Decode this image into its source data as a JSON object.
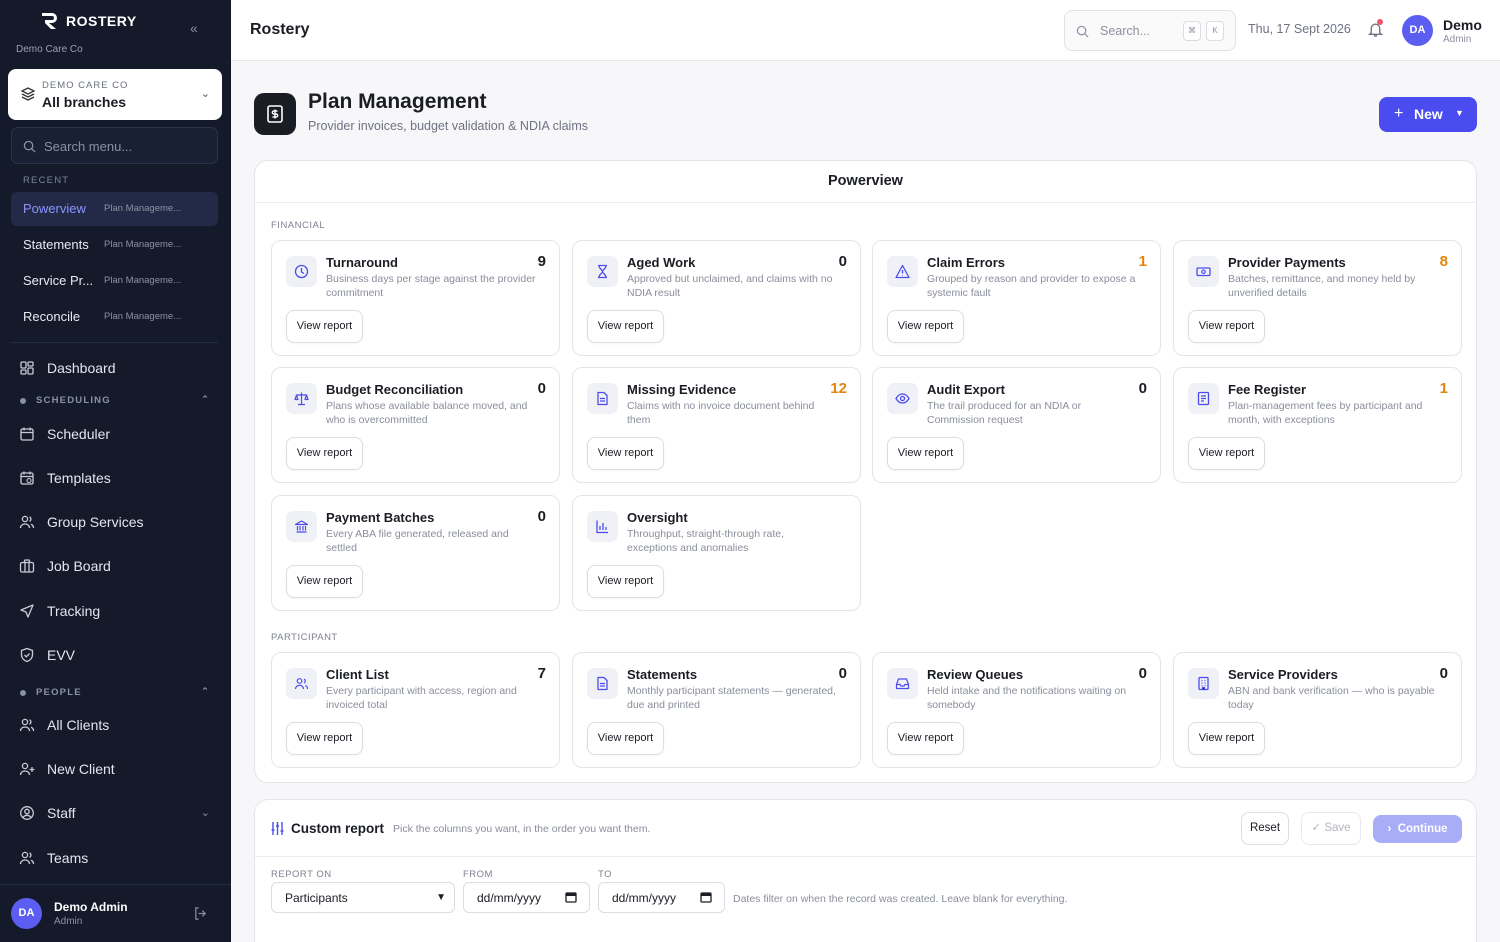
{
  "sidebar": {
    "brand": "ROSTERY",
    "org": "Demo Care Co",
    "branch_label": "DEMO CARE CO",
    "branch_value": "All branches",
    "search_placeholder": "Search menu...",
    "recent_label": "RECENT",
    "recent": [
      {
        "title": "Powerview",
        "sub": "Plan Manageme..."
      },
      {
        "title": "Statements",
        "sub": "Plan Manageme..."
      },
      {
        "title": "Service Pr...",
        "sub": "Plan Manageme..."
      },
      {
        "title": "Reconcile",
        "sub": "Plan Manageme..."
      }
    ],
    "dashboard": "Dashboard",
    "scheduling_label": "SCHEDULING",
    "scheduling": [
      "Scheduler",
      "Templates",
      "Group Services",
      "Job Board",
      "Tracking",
      "EVV"
    ],
    "people_label": "PEOPLE",
    "people": [
      "All Clients",
      "New Client",
      "Staff",
      "Teams"
    ],
    "user": {
      "initials": "DA",
      "name": "Demo Admin",
      "role": "Admin"
    }
  },
  "topbar": {
    "title": "Rostery",
    "search_placeholder": "Search...",
    "kbd1": "⌘",
    "kbd2": "K",
    "date": "Thu, 17 Sept 2026",
    "user_initials": "DA",
    "user_name": "Demo",
    "user_role": "Admin"
  },
  "page": {
    "title": "Plan Management",
    "subtitle": "Provider invoices, budget validation & NDIA claims",
    "new_label": "New"
  },
  "powerview": {
    "title": "Powerview",
    "view_label": "View report",
    "financial_label": "FINANCIAL",
    "participant_label": "PARTICIPANT",
    "financial": [
      {
        "title": "Turnaround",
        "desc": "Business days per stage against the provider commitment",
        "count": "9",
        "icon": "clock-icon"
      },
      {
        "title": "Aged Work",
        "desc": "Approved but unclaimed, and claims with no NDIA result",
        "count": "0",
        "icon": "hourglass-icon"
      },
      {
        "title": "Claim Errors",
        "desc": "Grouped by reason and provider to expose a systemic fault",
        "count": "1",
        "icon": "warning-icon"
      },
      {
        "title": "Provider Payments",
        "desc": "Batches, remittance, and money held by unverified details",
        "count": "8",
        "icon": "banknote-icon"
      },
      {
        "title": "Budget Reconciliation",
        "desc": "Plans whose available balance moved, and who is overcommitted",
        "count": "0",
        "icon": "scale-icon"
      },
      {
        "title": "Missing Evidence",
        "desc": "Claims with no invoice document behind them",
        "count": "12",
        "icon": "document-icon"
      },
      {
        "title": "Audit Export",
        "desc": "The trail produced for an NDIA or Commission request",
        "count": "0",
        "icon": "eye-icon"
      },
      {
        "title": "Fee Register",
        "desc": "Plan-management fees by participant and month, with exceptions",
        "count": "1",
        "icon": "receipt-icon"
      },
      {
        "title": "Payment Batches",
        "desc": "Every ABA file generated, released and settled",
        "count": "0",
        "icon": "bank-icon"
      },
      {
        "title": "Oversight",
        "desc": "Throughput, straight-through rate, exceptions and anomalies",
        "count": "",
        "icon": "bar-chart-icon"
      }
    ],
    "participant": [
      {
        "title": "Client List",
        "desc": "Every participant with access, region and invoiced total",
        "count": "7",
        "icon": "users-icon"
      },
      {
        "title": "Statements",
        "desc": "Monthly participant statements — generated, due and printed",
        "count": "0",
        "icon": "document-icon"
      },
      {
        "title": "Review Queues",
        "desc": "Held intake and the notifications waiting on somebody",
        "count": "0",
        "icon": "inbox-icon"
      },
      {
        "title": "Service Providers",
        "desc": "ABN and bank verification — who is payable today",
        "count": "0",
        "icon": "building-icon"
      }
    ]
  },
  "custom_report": {
    "title": "Custom report",
    "hint": "Pick the columns you want, in the order you want them.",
    "reset": "Reset",
    "save": "Save",
    "continue": "Continue",
    "report_on_label": "REPORT ON",
    "report_on_value": "Participants",
    "from_label": "FROM",
    "from_value": "dd/mm/yyyy",
    "to_label": "TO",
    "to_value": "dd/mm/yyyy",
    "note": "Dates filter on when the record was created. Leave blank for everything."
  },
  "colors": {
    "accent": "#4b4cf0",
    "sidebar_bg": "#151a2b",
    "warn_count": "#e0860a",
    "notification_dot": "#f0556a"
  }
}
